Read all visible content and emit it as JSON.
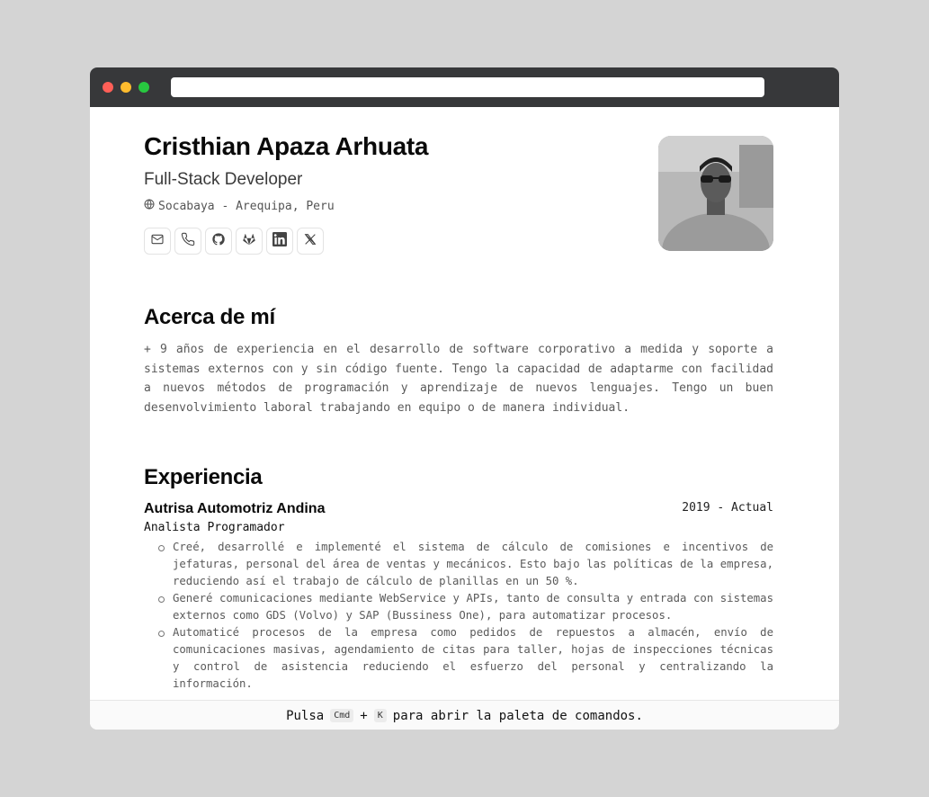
{
  "window": {
    "url": "",
    "controls": [
      "close",
      "minimize",
      "zoom"
    ]
  },
  "profile": {
    "name": "Cristhian Apaza Arhuata",
    "role": "Full-Stack Developer",
    "location": "Socabaya - Arequipa, Peru",
    "location_icon": "globe-icon",
    "avatar": "profile-photo",
    "socials": [
      {
        "icon": "mail-icon",
        "label": "Email"
      },
      {
        "icon": "phone-icon",
        "label": "Phone"
      },
      {
        "icon": "github-icon",
        "label": "GitHub"
      },
      {
        "icon": "gitlab-icon",
        "label": "GitLab"
      },
      {
        "icon": "linkedin-icon",
        "label": "LinkedIn"
      },
      {
        "icon": "x-icon",
        "label": "X"
      }
    ]
  },
  "about": {
    "title": "Acerca de mí",
    "text": "+ 9 años de experiencia en el desarrollo de software corporativo a medida y soporte a sistemas externos con y sin código fuente. Tengo la capacidad de adaptarme con facilidad a nuevos métodos de programación y aprendizaje de nuevos lenguajes. Tengo un buen desenvolvimiento laboral trabajando en equipo o de manera individual."
  },
  "experience": {
    "title": "Experiencia",
    "items": [
      {
        "company": "Autrisa Automotriz Andina",
        "period": "2019 - Actual",
        "position": "Analista Programador",
        "tasks": [
          "Creé, desarrollé e implementé el sistema de cálculo de comisiones e incentivos de jefaturas, personal del área de ventas y mecánicos. Esto bajo las políticas de la empresa, reduciendo así el trabajo de cálculo de planillas en un 50 %.",
          "Generé comunicaciones mediante WebService y APIs, tanto de consulta y entrada con sistemas externos como GDS (Volvo) y SAP (Bussiness One), para automatizar procesos.",
          "Automaticé procesos de la empresa como pedidos de repuestos a almacén, envío de comunicaciones masivas, agendamiento de citas para taller, hojas de inspecciones técnicas y control de asistencia reduciendo el esfuerzo del personal y centralizando la información."
        ]
      }
    ]
  },
  "footer": {
    "prefix": "Pulsa",
    "key1": "Cmd",
    "plus": "+",
    "key2": "K",
    "suffix": "para abrir la paleta de comandos."
  },
  "colors": {
    "page_bg": "#d4d4d4",
    "titlebar": "#37383a",
    "close": "#ff5f57",
    "minimize": "#febc2e",
    "zoom": "#28c840"
  }
}
